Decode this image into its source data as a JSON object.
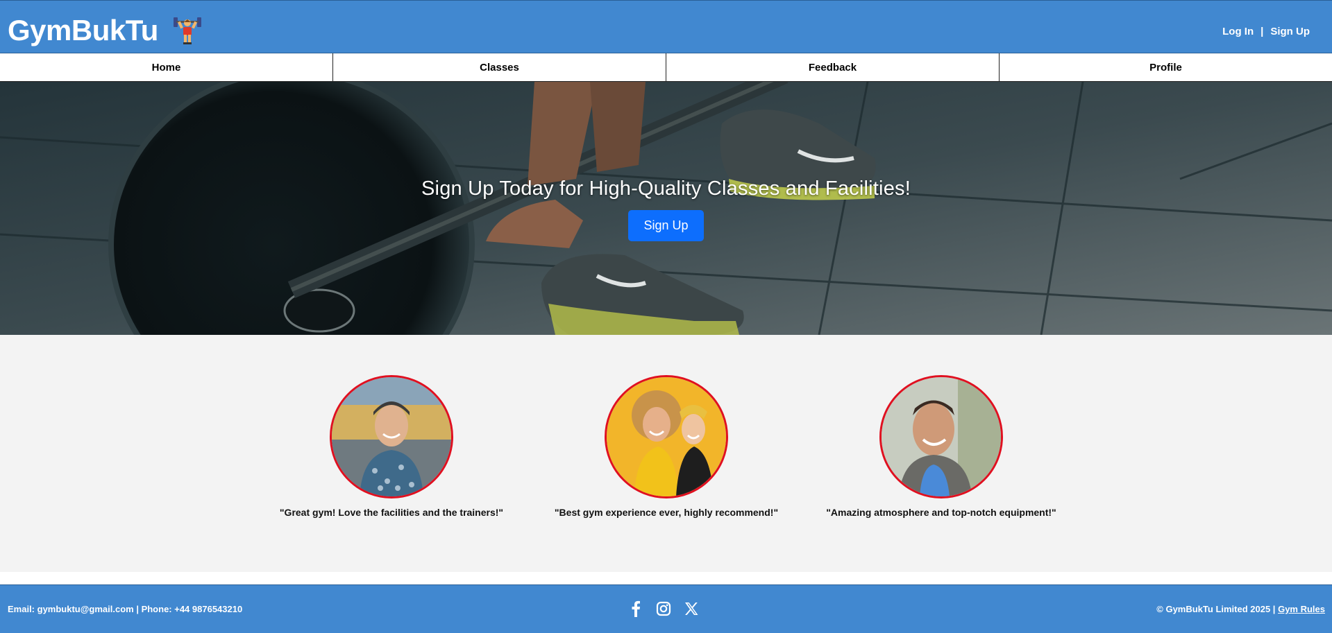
{
  "header": {
    "brand": "GymBukTu",
    "brand_icon": "weightlifter-icon",
    "login_label": "Log In",
    "separator": "|",
    "signup_label": "Sign Up",
    "background_color": "#4188d0"
  },
  "nav": {
    "items": [
      {
        "label": "Home"
      },
      {
        "label": "Classes"
      },
      {
        "label": "Feedback"
      },
      {
        "label": "Profile"
      }
    ]
  },
  "hero": {
    "title": "Sign Up Today for High-Quality Classes and Facilities!",
    "button_label": "Sign Up",
    "button_color": "#0d6efd",
    "background_image": "barbell-deadlift-photo"
  },
  "testimonials": [
    {
      "photo": "smiling-man-cap-photo",
      "quote": "\"Great gym! Love the facilities and the trainers!\""
    },
    {
      "photo": "two-women-laughing-photo",
      "quote": "\"Best gym experience ever, highly recommend!\""
    },
    {
      "photo": "smiling-man-hoodie-photo",
      "quote": "\"Amazing atmosphere and top-notch equipment!\""
    }
  ],
  "footer": {
    "contact": "Email: gymbuktu@gmail.com | Phone: +44 9876543210",
    "socials": [
      "facebook-icon",
      "instagram-icon",
      "x-icon"
    ],
    "copyright": "© GymBukTu Limited 2025 |",
    "rules_link": "Gym Rules"
  }
}
